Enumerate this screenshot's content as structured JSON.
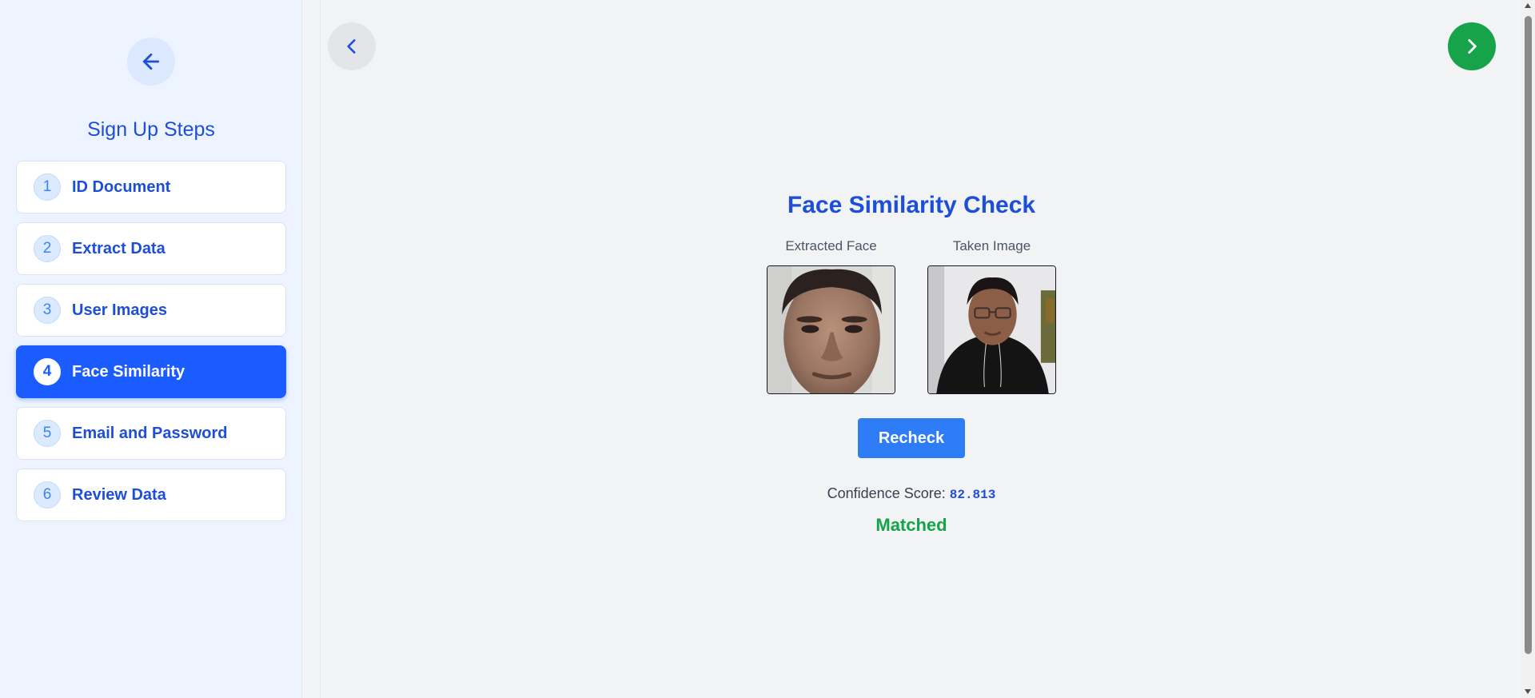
{
  "sidebar": {
    "back_icon": "arrow-left-icon",
    "title": "Sign Up Steps",
    "steps": [
      {
        "number": "1",
        "label": "ID Document",
        "active": false
      },
      {
        "number": "2",
        "label": "Extract Data",
        "active": false
      },
      {
        "number": "3",
        "label": "User Images",
        "active": false
      },
      {
        "number": "4",
        "label": "Face Similarity",
        "active": true
      },
      {
        "number": "5",
        "label": "Email and Password",
        "active": false
      },
      {
        "number": "6",
        "label": "Review Data",
        "active": false
      }
    ]
  },
  "nav": {
    "prev_icon": "chevron-left-icon",
    "next_icon": "chevron-right-icon"
  },
  "main": {
    "title": "Face Similarity Check",
    "extracted_label": "Extracted Face",
    "taken_label": "Taken Image",
    "recheck_label": "Recheck",
    "score_label": "Confidence Score:",
    "score_value": "82.813",
    "result": "Matched"
  },
  "colors": {
    "accent": "#1d4ed8",
    "active_step": "#1a5cff",
    "next_button": "#16a34a",
    "recheck_button": "#2f7df6",
    "matched": "#16a34a"
  }
}
